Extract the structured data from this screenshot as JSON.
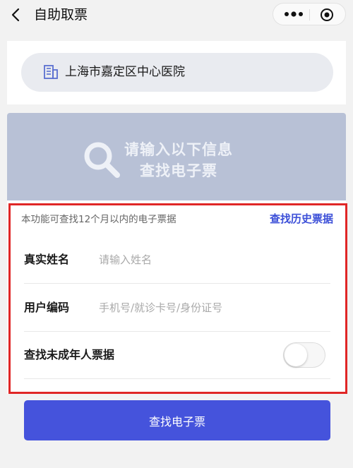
{
  "header": {
    "title": "自助取票",
    "back_icon": "chevron-left-icon",
    "more_icon": "more-dots-icon",
    "close_icon": "target-circle-icon"
  },
  "hospital": {
    "name": "上海市嘉定区中心医院",
    "icon": "building-icon"
  },
  "banner": {
    "line1": "请输入以下信息",
    "line2": "查找电子票",
    "icon": "search-icon",
    "color": "#b8c1d6"
  },
  "form": {
    "note": "本功能可查找12个月以内的电子票据",
    "history_link": "查找历史票据",
    "name_label": "真实姓名",
    "name_placeholder": "请输入姓名",
    "code_label": "用户编码",
    "code_placeholder": "手机号/就诊卡号/身份证号",
    "minor_label": "查找未成年人票据",
    "minor_toggle_on": false
  },
  "submit": {
    "label": "查找电子票",
    "color": "#4553dc"
  },
  "accent": "#3c4fd8",
  "highlight_frame_color": "#e02626"
}
